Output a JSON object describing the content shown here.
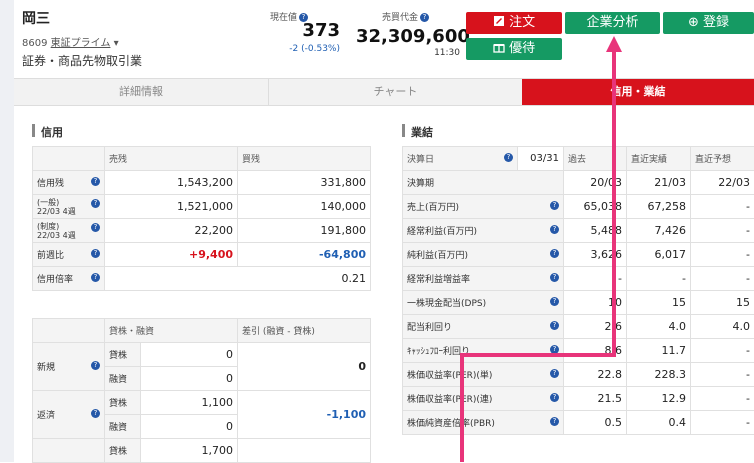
{
  "header": {
    "name": "岡三",
    "code": "8609",
    "market": "東証プライム",
    "industry": "証券・商品先物取引業",
    "price_label": "現在値",
    "price": "373",
    "change": "-2 (-0.53%)",
    "turnover_label": "売買代金",
    "turnover": "32,309,600",
    "time": "11:30",
    "question_mark": "?"
  },
  "buttons": {
    "order": "注文",
    "analysis": "企業分析",
    "register": "登録",
    "yutai": "優待"
  },
  "icons": {
    "order": "order-icon",
    "register": "plus-circle-icon",
    "yutai": "gift-icon",
    "market_dropdown": "chevron-down-icon"
  },
  "tabs": [
    "詳細情報",
    "チャート",
    "信用・業結"
  ],
  "credit": {
    "title": "信用",
    "head": [
      "売残",
      "買残"
    ],
    "rows": [
      {
        "label": "信用残",
        "sell": "1,543,200",
        "buy": "331,800"
      },
      {
        "label": "(一般)",
        "sub": "22/03 4週",
        "sell": "1,521,000",
        "buy": "140,000"
      },
      {
        "label": "(制度)",
        "sub": "22/03 4週",
        "sell": "22,200",
        "buy": "191,800"
      },
      {
        "label": "前週比",
        "sell": "+9,400",
        "buy": "-64,800"
      },
      {
        "label": "信用倍率",
        "sell": "",
        "buy": "0.21"
      }
    ]
  },
  "lending": {
    "head": [
      "貸株・融資",
      "差引 (融資 - 貸株)"
    ],
    "groups": [
      {
        "label": "新規",
        "rows": [
          {
            "k": "貸株",
            "v": "0"
          },
          {
            "k": "融資",
            "v": "0"
          }
        ],
        "diff": "0"
      },
      {
        "label": "返済",
        "rows": [
          {
            "k": "貸株",
            "v": "1,100"
          },
          {
            "k": "融資",
            "v": "0"
          }
        ],
        "diff": "-1,100"
      },
      {
        "label": "",
        "rows": [
          {
            "k": "貸株",
            "v": "1,700"
          }
        ],
        "diff": ""
      }
    ]
  },
  "results": {
    "title": "業結",
    "head": [
      "決算日",
      "03/31",
      "過去",
      "直近実績",
      "直近予想"
    ],
    "rows": [
      {
        "label": "決算期",
        "vals": [
          "20/03",
          "21/03",
          "22/03"
        ]
      },
      {
        "label": "売上(百万円)",
        "vals": [
          "65,038",
          "67,258",
          "-"
        ]
      },
      {
        "label": "経常利益(百万円)",
        "vals": [
          "5,488",
          "7,426",
          "-"
        ]
      },
      {
        "label": "純利益(百万円)",
        "vals": [
          "3,626",
          "6,017",
          "-"
        ]
      },
      {
        "label": "経常利益増益率",
        "vals": [
          "-",
          "-",
          "-"
        ]
      },
      {
        "label": "一株現金配当(DPS)",
        "vals": [
          "10",
          "15",
          "15"
        ]
      },
      {
        "label": "配当利回り",
        "vals": [
          "2.6",
          "4.0",
          "4.0"
        ]
      },
      {
        "label": "ｷｬｯｼｭﾌﾛｰ利回り",
        "vals": [
          "8.6",
          "11.7",
          "-"
        ]
      },
      {
        "label": "株価収益率(PER)(単)",
        "vals": [
          "22.8",
          "228.3",
          "-"
        ]
      },
      {
        "label": "株価収益率(PER)(連)",
        "vals": [
          "21.5",
          "12.9",
          "-"
        ]
      },
      {
        "label": "株価純資産倍率(PBR)",
        "vals": [
          "0.5",
          "0.4",
          "-"
        ]
      }
    ]
  },
  "colors": {
    "red": "#d7121c",
    "green": "#159a63",
    "blue": "#1f5fb3",
    "annotation": "#e8347a"
  }
}
